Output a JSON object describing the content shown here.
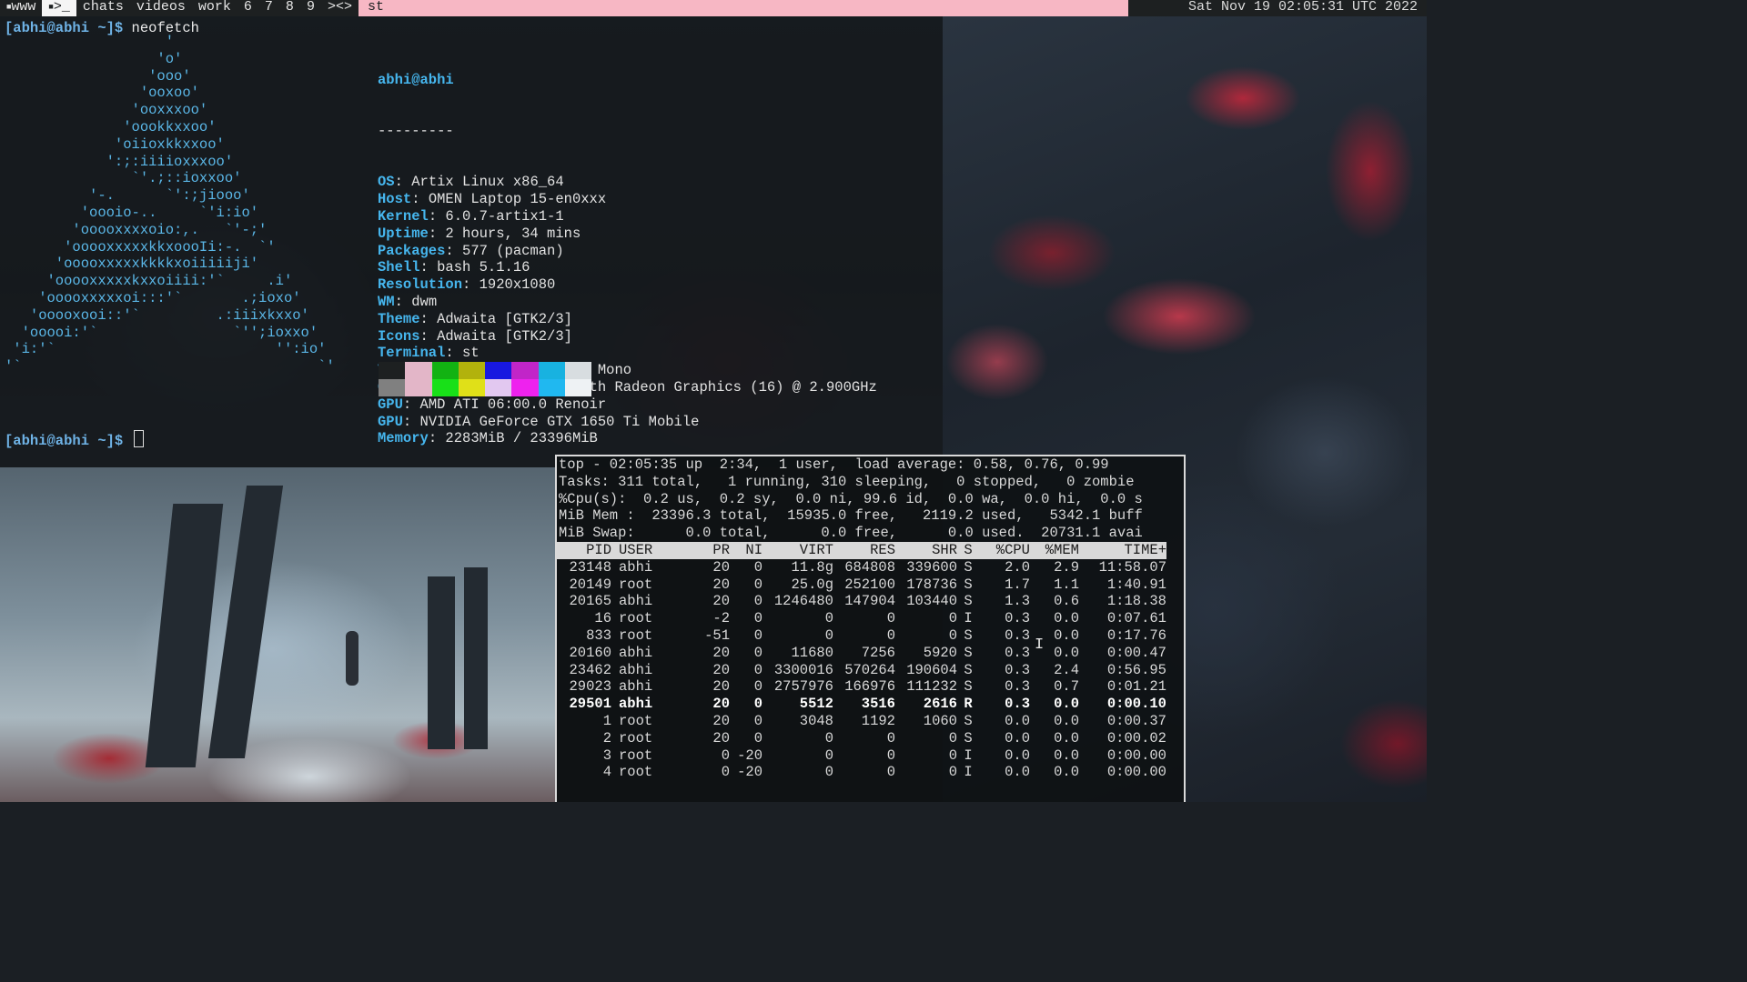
{
  "topbar": {
    "tags": [
      {
        "label": "www",
        "active": false,
        "occupied": true
      },
      {
        "label": ">_",
        "active": true,
        "occupied": true
      },
      {
        "label": "chats",
        "active": false
      },
      {
        "label": "videos",
        "active": false
      },
      {
        "label": "work",
        "active": false
      },
      {
        "label": "6",
        "active": false
      },
      {
        "label": "7",
        "active": false
      },
      {
        "label": "8",
        "active": false
      },
      {
        "label": "9",
        "active": false
      }
    ],
    "layout": "><>",
    "window_title": "st",
    "status": "Sat Nov 19 02:05:31 UTC 2022"
  },
  "terminal1": {
    "prompt": "[abhi@abhi ~]$",
    "command": "neofetch",
    "logo": [
      "                   '",
      "                  'o'",
      "                 'ooo'",
      "                'ooxoo'",
      "               'ooxxxoo'",
      "              'oookkxxoo'",
      "             'oiioxkkxxoo'",
      "            ':;:iiiioxxxoo'",
      "               `'.;::ioxxoo'",
      "          '-.      `':;jiooo'",
      "         'oooio-..     `'i:io'",
      "        'ooooxxxxoio:,.   `'-;'",
      "       'ooooxxxxxkkxoooIi:-.  `'",
      "      'ooooxxxxxkkkkxoiiiiiji'",
      "     'ooooxxxxxkxxoiiii:'`     .i'",
      "    'ooooxxxxxoi:::'`       .;ioxo'",
      "   'ooooxooi::'`         .:iiixkxxo'",
      "  'ooooi:'`                `'';ioxxo'",
      " 'i:'`                          '':io'",
      "'`                                   `'"
    ],
    "header": "abhi@abhi",
    "separator": "---------",
    "info": [
      {
        "key": "OS",
        "value": "Artix Linux x86_64"
      },
      {
        "key": "Host",
        "value": "OMEN Laptop 15-en0xxx"
      },
      {
        "key": "Kernel",
        "value": "6.0.7-artix1-1"
      },
      {
        "key": "Uptime",
        "value": "2 hours, 34 mins"
      },
      {
        "key": "Packages",
        "value": "577 (pacman)"
      },
      {
        "key": "Shell",
        "value": "bash 5.1.16"
      },
      {
        "key": "Resolution",
        "value": "1920x1080"
      },
      {
        "key": "WM",
        "value": "dwm"
      },
      {
        "key": "Theme",
        "value": "Adwaita [GTK2/3]"
      },
      {
        "key": "Icons",
        "value": "Adwaita [GTK2/3]"
      },
      {
        "key": "Terminal",
        "value": "st"
      },
      {
        "key": "Terminal Font",
        "value": "Liberation Mono"
      },
      {
        "key": "CPU",
        "value": "AMD Ryzen 7 4800H with Radeon Graphics (16) @ 2.900GHz"
      },
      {
        "key": "GPU",
        "value": "AMD ATI 06:00.0 Renoir"
      },
      {
        "key": "GPU",
        "value": "NVIDIA GeForce GTX 1650 Ti Mobile"
      },
      {
        "key": "Memory",
        "value": "2283MiB / 23396MiB"
      }
    ],
    "palette_top": [
      "#1d2021",
      "#e3b6c8",
      "#12b212",
      "#b2b20c",
      "#1818e0",
      "#c125c8",
      "#18b2e0",
      "#d8dde0"
    ],
    "palette_bottom": [
      "#808080",
      "#e3b6c8",
      "#18e018",
      "#e0e018",
      "#e2c8f0",
      "#ee22ee",
      "#20b8f0",
      "#eef2f4"
    ],
    "prompt2": "[abhi@abhi ~]$"
  },
  "top": {
    "summary": [
      "top - 02:05:35 up  2:34,  1 user,  load average: 0.58, 0.76, 0.99",
      "Tasks: 311 total,   1 running, 310 sleeping,   0 stopped,   0 zombie",
      "%Cpu(s):  0.2 us,  0.2 sy,  0.0 ni, 99.6 id,  0.0 wa,  0.0 hi,  0.0 s",
      "MiB Mem :  23396.3 total,  15935.0 free,   2119.2 used,   5342.1 buff",
      "MiB Swap:      0.0 total,      0.0 free,      0.0 used.  20731.1 avai"
    ],
    "columns": [
      "PID",
      "USER",
      "PR",
      "NI",
      "VIRT",
      "RES",
      "SHR",
      "S",
      "%CPU",
      "%MEM",
      "TIME+"
    ],
    "rows": [
      [
        "23148",
        "abhi",
        "20",
        "0",
        "11.8g",
        "684808",
        "339600",
        "S",
        "2.0",
        "2.9",
        "11:58.07"
      ],
      [
        "20149",
        "root",
        "20",
        "0",
        "25.0g",
        "252100",
        "178736",
        "S",
        "1.7",
        "1.1",
        "1:40.91"
      ],
      [
        "20165",
        "abhi",
        "20",
        "0",
        "1246480",
        "147904",
        "103440",
        "S",
        "1.3",
        "0.6",
        "1:18.38"
      ],
      [
        "16",
        "root",
        "-2",
        "0",
        "0",
        "0",
        "0",
        "I",
        "0.3",
        "0.0",
        "0:07.61"
      ],
      [
        "833",
        "root",
        "-51",
        "0",
        "0",
        "0",
        "0",
        "S",
        "0.3",
        "0.0",
        "0:17.76"
      ],
      [
        "20160",
        "abhi",
        "20",
        "0",
        "11680",
        "7256",
        "5920",
        "S",
        "0.3",
        "0.0",
        "0:00.47"
      ],
      [
        "23462",
        "abhi",
        "20",
        "0",
        "3300016",
        "570264",
        "190604",
        "S",
        "0.3",
        "2.4",
        "0:56.95"
      ],
      [
        "29023",
        "abhi",
        "20",
        "0",
        "2757976",
        "166976",
        "111232",
        "S",
        "0.3",
        "0.7",
        "0:01.21"
      ],
      [
        "29501",
        "abhi",
        "20",
        "0",
        "5512",
        "3516",
        "2616",
        "R",
        "0.3",
        "0.0",
        "0:00.10"
      ],
      [
        "1",
        "root",
        "20",
        "0",
        "3048",
        "1192",
        "1060",
        "S",
        "0.0",
        "0.0",
        "0:00.37"
      ],
      [
        "2",
        "root",
        "20",
        "0",
        "0",
        "0",
        "0",
        "S",
        "0.0",
        "0.0",
        "0:00.02"
      ],
      [
        "3",
        "root",
        "0",
        "-20",
        "0",
        "0",
        "0",
        "I",
        "0.0",
        "0.0",
        "0:00.00"
      ],
      [
        "4",
        "root",
        "0",
        "-20",
        "0",
        "0",
        "0",
        "I",
        "0.0",
        "0.0",
        "0:00.00"
      ]
    ],
    "highlight_pid": "29501"
  }
}
